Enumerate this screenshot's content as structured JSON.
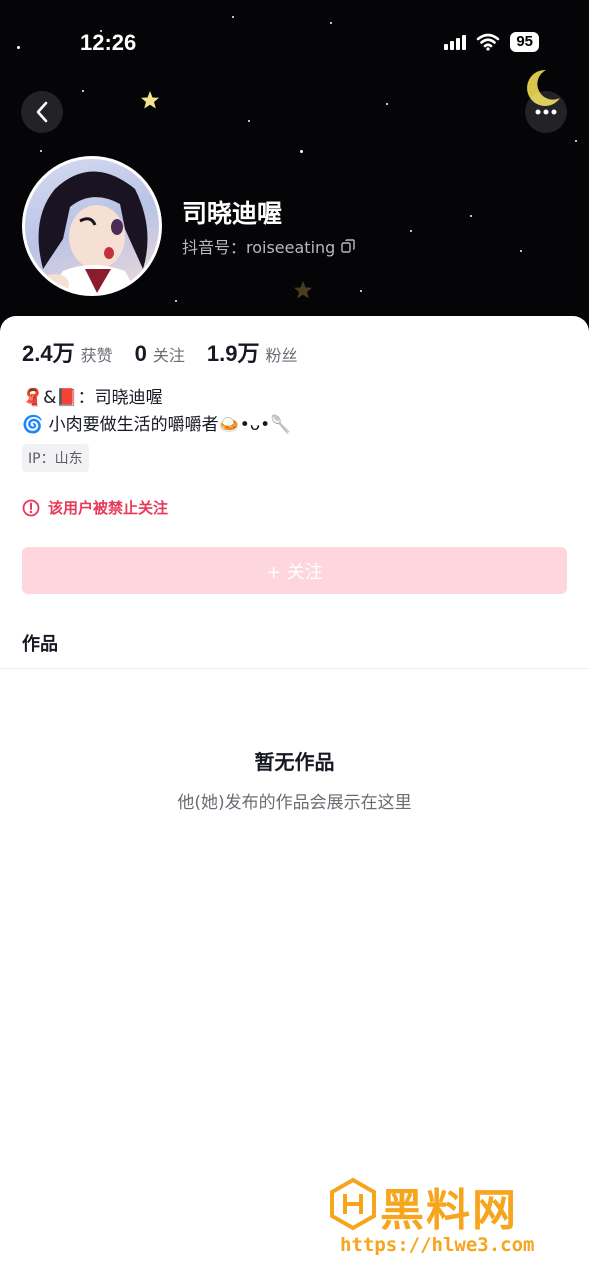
{
  "status_bar": {
    "time": "12:26",
    "battery": "95"
  },
  "profile": {
    "name": "司晓迪喔",
    "handle_label": "抖音号：roiseeating"
  },
  "stats": [
    {
      "value": "2.4万",
      "label": "获赞"
    },
    {
      "value": "0",
      "label": "关注"
    },
    {
      "value": "1.9万",
      "label": "粉丝"
    }
  ],
  "bio": {
    "line1": "🧣&📕：司晓迪喔",
    "line2": "🌀 小肉要做生活的嚼嚼者🍛•ᴗ•🥄"
  },
  "ip": "IP：山东",
  "ban_notice": "该用户被禁止关注",
  "follow_button": "+ 关注",
  "tab": "作品",
  "empty": {
    "title": "暂无作品",
    "subtitle": "他(她)发布的作品会展示在这里"
  },
  "watermark": {
    "text": "黑料网",
    "url": "https://hlwe3.com"
  },
  "colors": {
    "accent": "#e8395a",
    "follow_bg": "#fdd6de",
    "header_bg": "#050507",
    "watermark": "#f7a51c"
  }
}
